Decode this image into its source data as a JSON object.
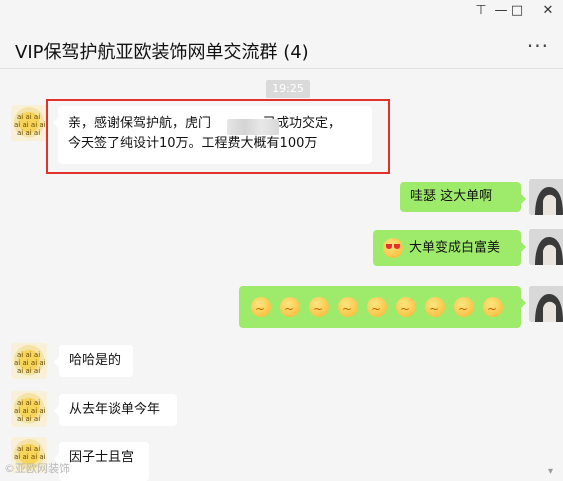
{
  "window": {
    "title": "VIP保驾护航亚欧装饰网单交流群 (4)",
    "controls": {
      "pin": "⊤",
      "minimize": "—",
      "maximize": "□",
      "close": "✕"
    },
    "more_label": "···"
  },
  "chat": {
    "timestamp": "19:25",
    "messages": [
      {
        "side": "left",
        "line1": "亲，感谢保驾护航，虎门",
        "line1_tail": "已成功交定，",
        "line2": "今天签了纯设计10万。工程费大概有100万"
      },
      {
        "side": "right",
        "text": "哇瑟  这大单啊"
      },
      {
        "side": "right",
        "text": "大单变成白富美",
        "emoji": "heart-eyes-emoji"
      },
      {
        "side": "right",
        "emoji_count": 9,
        "emoji": "crying-laughing-emoji"
      },
      {
        "side": "left",
        "text": "哈哈是的"
      },
      {
        "side": "left",
        "text": "从去年谈单今年"
      },
      {
        "side": "left",
        "text": "因子士且宫"
      }
    ]
  },
  "footer": {
    "watermark": "©亚欧网装饰"
  },
  "colors": {
    "highlight_box": "#e0322b",
    "sent_bubble": "#9eea6a",
    "received_bubble": "#ffffff",
    "background": "#f5f5f5"
  }
}
